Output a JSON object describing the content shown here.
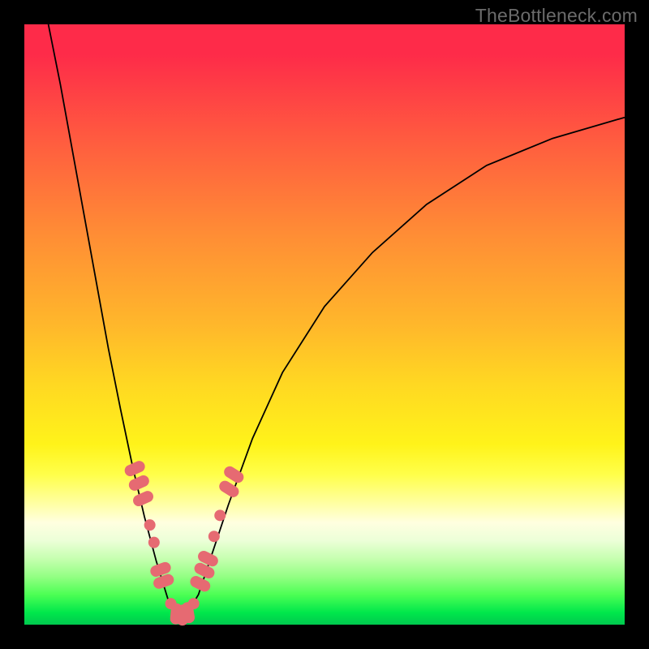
{
  "watermark": "TheBottleneck.com",
  "colors": {
    "frame": "#000000",
    "bead": "#e66a72",
    "curve": "#000000",
    "gradient_top": "#fe2b49",
    "gradient_bottom": "#00c94e"
  },
  "chart_data": {
    "type": "line",
    "title": "",
    "xlabel": "",
    "ylabel": "",
    "xlim": [
      0,
      100
    ],
    "ylim": [
      0,
      100
    ],
    "description": "Two bottleneck curves meeting at a minimum near x≈25; background gradient from red (high bottleneck) at top to green (low bottleneck) at bottom.",
    "series": [
      {
        "name": "left_curve",
        "x": [
          4,
          6,
          8,
          10,
          12,
          14,
          16,
          18,
          20,
          22,
          24,
          25
        ],
        "values": [
          100,
          90,
          79,
          68,
          57,
          46,
          36,
          26.5,
          18,
          10.5,
          4,
          1.7
        ]
      },
      {
        "name": "right_curve",
        "x": [
          27,
          29,
          31,
          34,
          38,
          43,
          50,
          58,
          67,
          77,
          88,
          100
        ],
        "values": [
          1.7,
          5,
          11,
          20,
          31,
          42,
          53,
          62,
          70,
          76.5,
          81,
          84.5
        ]
      }
    ],
    "markers": [
      {
        "x": 18.4,
        "y": 26.0,
        "shape": "round-cap",
        "angle": 66
      },
      {
        "x": 19.1,
        "y": 23.6,
        "shape": "round-cap",
        "angle": 66
      },
      {
        "x": 19.8,
        "y": 21.0,
        "shape": "round-cap",
        "angle": 66
      },
      {
        "x": 20.9,
        "y": 16.6,
        "shape": "dot"
      },
      {
        "x": 21.6,
        "y": 13.7,
        "shape": "dot"
      },
      {
        "x": 22.7,
        "y": 9.2,
        "shape": "round-cap",
        "angle": 70
      },
      {
        "x": 23.2,
        "y": 7.2,
        "shape": "round-cap",
        "angle": 70
      },
      {
        "x": 24.4,
        "y": 3.5,
        "shape": "dot"
      },
      {
        "x": 25.3,
        "y": 1.8,
        "shape": "round-cap",
        "angle": 5
      },
      {
        "x": 26.4,
        "y": 1.6,
        "shape": "round-cap",
        "angle": 5
      },
      {
        "x": 27.3,
        "y": 2.0,
        "shape": "round-cap",
        "angle": -10
      },
      {
        "x": 28.2,
        "y": 3.5,
        "shape": "dot"
      },
      {
        "x": 29.3,
        "y": 6.8,
        "shape": "round-cap",
        "angle": -64
      },
      {
        "x": 30.0,
        "y": 9.0,
        "shape": "round-cap",
        "angle": -64
      },
      {
        "x": 30.6,
        "y": 11.0,
        "shape": "round-cap",
        "angle": -64
      },
      {
        "x": 31.6,
        "y": 14.7,
        "shape": "dot"
      },
      {
        "x": 32.6,
        "y": 18.2,
        "shape": "dot"
      },
      {
        "x": 34.1,
        "y": 22.6,
        "shape": "round-cap",
        "angle": -58
      },
      {
        "x": 34.9,
        "y": 25.0,
        "shape": "round-cap",
        "angle": -58
      }
    ]
  }
}
